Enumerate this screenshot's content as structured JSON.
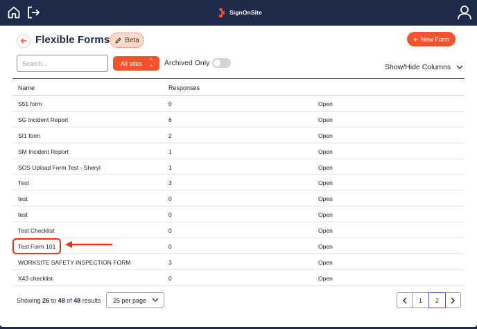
{
  "brand": {
    "name": "SignOnSite",
    "logo_icon": "signonsite-logo-icon"
  },
  "topbar": {
    "icons": [
      "home-icon",
      "logout-icon",
      "user-icon"
    ]
  },
  "page": {
    "title": "Flexible Forms",
    "beta_label": "Beta",
    "new_form_label": "New Form"
  },
  "filters": {
    "search_placeholder": "Search...",
    "sites_label": "All sites",
    "archived_label": "Archived Only",
    "archived_on": false,
    "show_hide_label": "Show/Hide Columns"
  },
  "table": {
    "columns": [
      "Name",
      "Responses",
      ""
    ],
    "rows": [
      {
        "name": "S51 form",
        "responses": "0",
        "action": "Open"
      },
      {
        "name": "SG Incident Report",
        "responses": "6",
        "action": "Open"
      },
      {
        "name": "SI1 form",
        "responses": "2",
        "action": "Open"
      },
      {
        "name": "SM Incident Report",
        "responses": "1",
        "action": "Open"
      },
      {
        "name": "SOS Upload Form Test - Sheryl",
        "responses": "1",
        "action": "Open"
      },
      {
        "name": "Test",
        "responses": "3",
        "action": "Open"
      },
      {
        "name": "test",
        "responses": "0",
        "action": "Open"
      },
      {
        "name": "test",
        "responses": "0",
        "action": "Open"
      },
      {
        "name": "Test Checklist",
        "responses": "0",
        "action": "Open"
      },
      {
        "name": "Test Form 101",
        "responses": "0",
        "action": "Open"
      },
      {
        "name": "WORKSITE SAFETY INSPECTION FORM",
        "responses": "3",
        "action": "Open"
      },
      {
        "name": "X43 checklist",
        "responses": "0",
        "action": "Open"
      }
    ]
  },
  "footer": {
    "showing_prefix": "Showing",
    "range_start": "26",
    "to_word": "to",
    "range_end": "48",
    "of_word": "of",
    "total": "48",
    "results_word": "results",
    "per_page_label": "25 per page",
    "pages": [
      "1",
      "2"
    ],
    "current_page": "2"
  },
  "colors": {
    "accent": "#f4542c",
    "navy": "#1e2a4a",
    "annotation": "#e8321c"
  }
}
